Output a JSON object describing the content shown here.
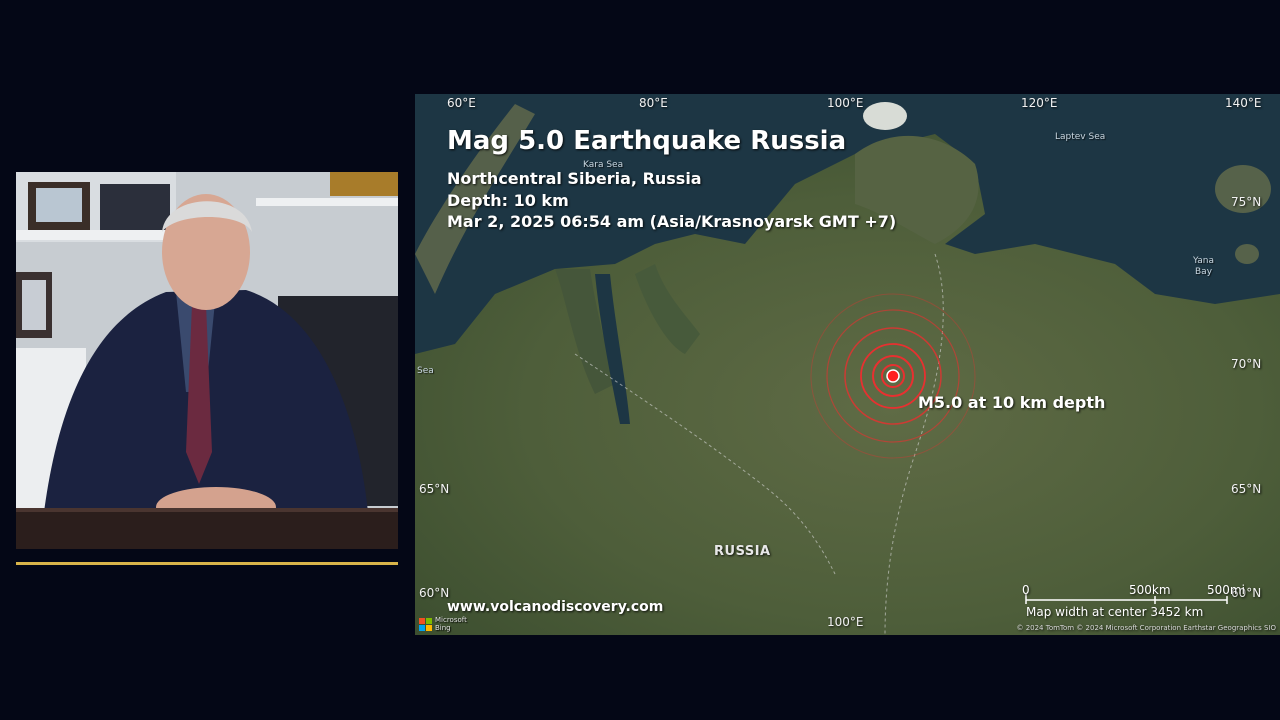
{
  "map": {
    "title": "Mag 5.0 Earthquake Russia",
    "region": "Northcentral Siberia, Russia",
    "depth": "Depth: 10 km",
    "datetime": "Mar 2, 2025 06:54 am (Asia/Krasnoyarsk GMT +7)",
    "marker_label": "M5.0 at 10 km depth",
    "country_label": "RUSSIA",
    "website": "www.volcanodiscovery.com",
    "longitudes_top": [
      "60°E",
      "80°E",
      "100°E",
      "120°E",
      "140°E"
    ],
    "longitude_bottom": "100°E",
    "latitudes_left": [
      "65°N",
      "60°N"
    ],
    "latitudes_right": [
      "75°N",
      "70°N",
      "65°N",
      "60°N"
    ],
    "seas": {
      "kara": "Kara Sea",
      "laptev": "Laptev Sea",
      "yana_line1": "Yana",
      "yana_line2": "Bay",
      "west": "Sea"
    },
    "scale": {
      "zero": "0",
      "km": "500km",
      "mi": "500mi",
      "width_note": "Map width at center 3452 km"
    },
    "copyright": "© 2024 TomTom © 2024 Microsoft Corporation Earthstar Geographics SIO",
    "bing_line1": "Microsoft",
    "bing_line2": "Bing",
    "colors": {
      "marker": "#ff2020",
      "rings": "#e83030",
      "accent_line": "#d9b44a",
      "background": "#040716"
    }
  }
}
